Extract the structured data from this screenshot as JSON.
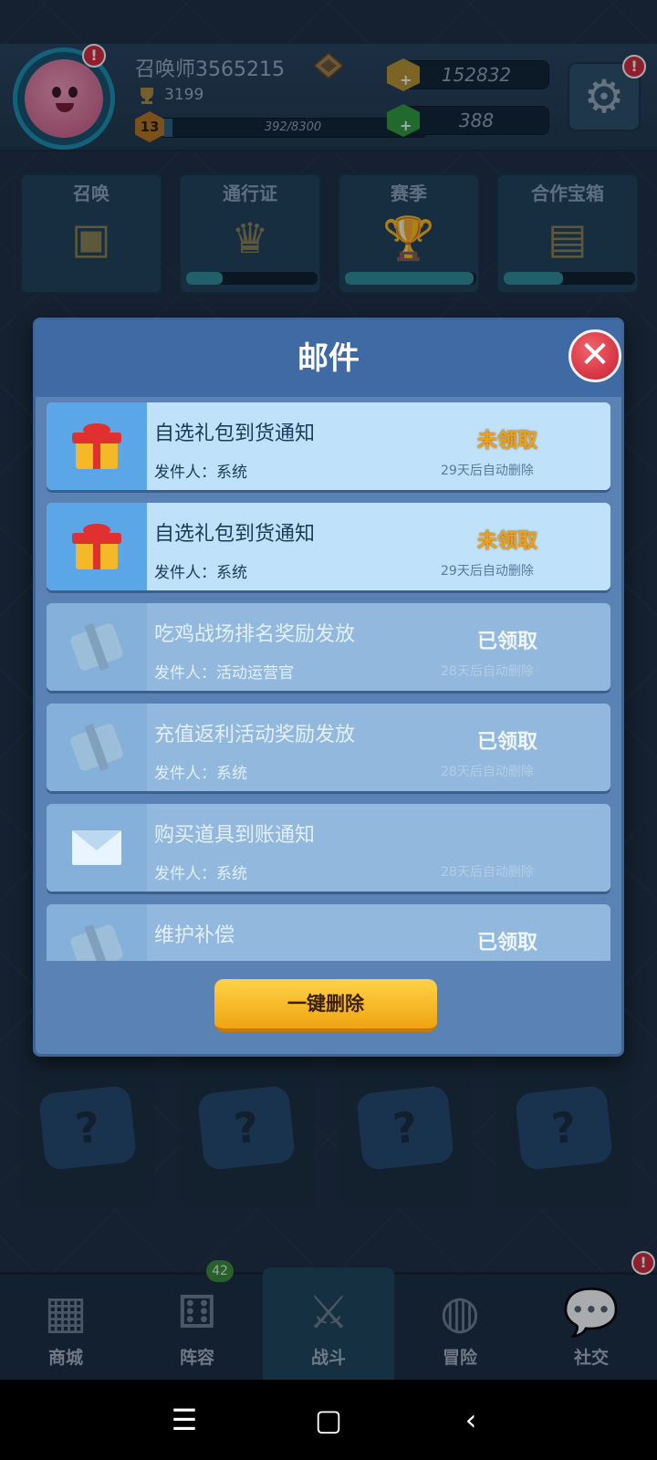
{
  "header": {
    "player_name": "召唤师3565215",
    "trophies": "3199",
    "level": "13",
    "xp_text": "392/8300",
    "xp_fraction": 0.047,
    "gold": "152832",
    "gems": "388",
    "avatar_alert": "!",
    "settings_alert": "!"
  },
  "tiles": [
    {
      "label": "召唤",
      "progress": null
    },
    {
      "label": "通行证",
      "progress": 0.28
    },
    {
      "label": "赛季",
      "progress": 0.98
    },
    {
      "label": "合作宝箱",
      "progress": 0.45
    }
  ],
  "mail_dialog": {
    "title": "邮件",
    "close_label": "✕",
    "delete_all_label": "一键删除",
    "items": [
      {
        "title": "自选礼包到货通知",
        "sender": "发件人：系统",
        "status": "未领取",
        "expire": "29天后自动删除",
        "icon": "gift-icon",
        "state": "unread"
      },
      {
        "title": "自选礼包到货通知",
        "sender": "发件人：系统",
        "status": "未领取",
        "expire": "29天后自动删除",
        "icon": "gift-icon",
        "state": "unread"
      },
      {
        "title": "吃鸡战场排名奖励发放",
        "sender": "发件人：活动运营官",
        "status": "已领取",
        "expire": "28天后自动删除",
        "icon": "package-icon",
        "state": "read"
      },
      {
        "title": "充值返利活动奖励发放",
        "sender": "发件人：系统",
        "status": "已领取",
        "expire": "28天后自动删除",
        "icon": "package-icon",
        "state": "read"
      },
      {
        "title": "购买道具到账通知",
        "sender": "发件人：系统",
        "status": "",
        "expire": "28天后自动删除",
        "icon": "envelope-icon",
        "state": "read"
      },
      {
        "title": "维护补偿",
        "sender": "",
        "status": "已领取",
        "expire": "",
        "icon": "package-icon",
        "state": "read"
      }
    ]
  },
  "nav": {
    "items": [
      {
        "label": "商城",
        "icon": "shop-icon"
      },
      {
        "label": "阵容",
        "icon": "dice-icon",
        "count": "42"
      },
      {
        "label": "战斗",
        "icon": "crossed-swords-icon"
      },
      {
        "label": "冒险",
        "icon": "planet-icon"
      },
      {
        "label": "社交",
        "icon": "chat-icon",
        "alert": "!"
      }
    ]
  },
  "colors": {
    "unclaimed": "#f0a018",
    "accent_button": "#ffd246",
    "dialog_bg": "#5a82b4"
  }
}
